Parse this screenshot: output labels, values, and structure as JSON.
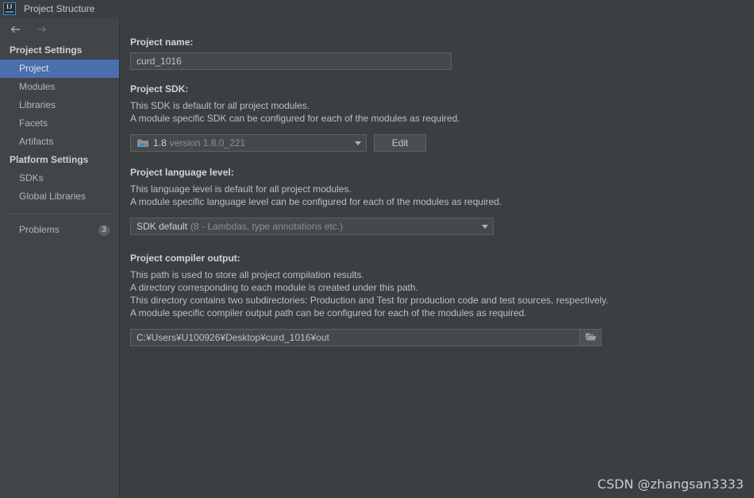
{
  "window": {
    "title": "Project Structure",
    "app_icon": "intellij-idea-icon"
  },
  "nav": {
    "back_icon": "arrow-left-icon",
    "forward_icon": "arrow-right-icon"
  },
  "sidebar": {
    "groups": [
      {
        "header": "Project Settings",
        "items": [
          {
            "label": "Project",
            "selected": true
          },
          {
            "label": "Modules",
            "selected": false
          },
          {
            "label": "Libraries",
            "selected": false
          },
          {
            "label": "Facets",
            "selected": false
          },
          {
            "label": "Artifacts",
            "selected": false
          }
        ]
      },
      {
        "header": "Platform Settings",
        "items": [
          {
            "label": "SDKs",
            "selected": false
          },
          {
            "label": "Global Libraries",
            "selected": false
          }
        ]
      }
    ],
    "problems": {
      "label": "Problems",
      "badge": "3"
    }
  },
  "main": {
    "project_name": {
      "label": "Project name:",
      "value": "curd_1016",
      "placeholder": "Project name"
    },
    "project_sdk": {
      "label": "Project SDK:",
      "descriptions": [
        "This SDK is default for all project modules.",
        "A module specific SDK can be configured for each of the modules as required."
      ],
      "selected": "1.8",
      "selected_detail": "version 1.8.0_221",
      "sdk_icon": "java-folder-icon",
      "dropdown_icon": "chevron-down-icon",
      "edit_label": "Edit"
    },
    "language_level": {
      "label": "Project language level:",
      "descriptions": [
        "This language level is default for all project modules.",
        "A module specific language level can be configured for each of the modules as required."
      ],
      "selected": "SDK default",
      "selected_detail": "(8 - Lambdas, type annotations etc.)",
      "dropdown_icon": "chevron-down-icon"
    },
    "compiler_output": {
      "label": "Project compiler output:",
      "descriptions": [
        "This path is used to store all project compilation results.",
        "A directory corresponding to each module is created under this path.",
        "This directory contains two subdirectories: Production and Test for production code and test sources, respectively.",
        "A module specific compiler output path can be configured for each of the modules as required."
      ],
      "path": "C:¥Users¥U100926¥Desktop¥curd_1016¥out",
      "browse_icon": "folder-open-icon"
    }
  },
  "watermark": {
    "text": "CSDN @zhangsan3333"
  },
  "colors": {
    "selection": "#4b6eaf",
    "sidebar_bg": "#414448",
    "content_bg": "#3c3f41",
    "accent": "#3592c4"
  }
}
